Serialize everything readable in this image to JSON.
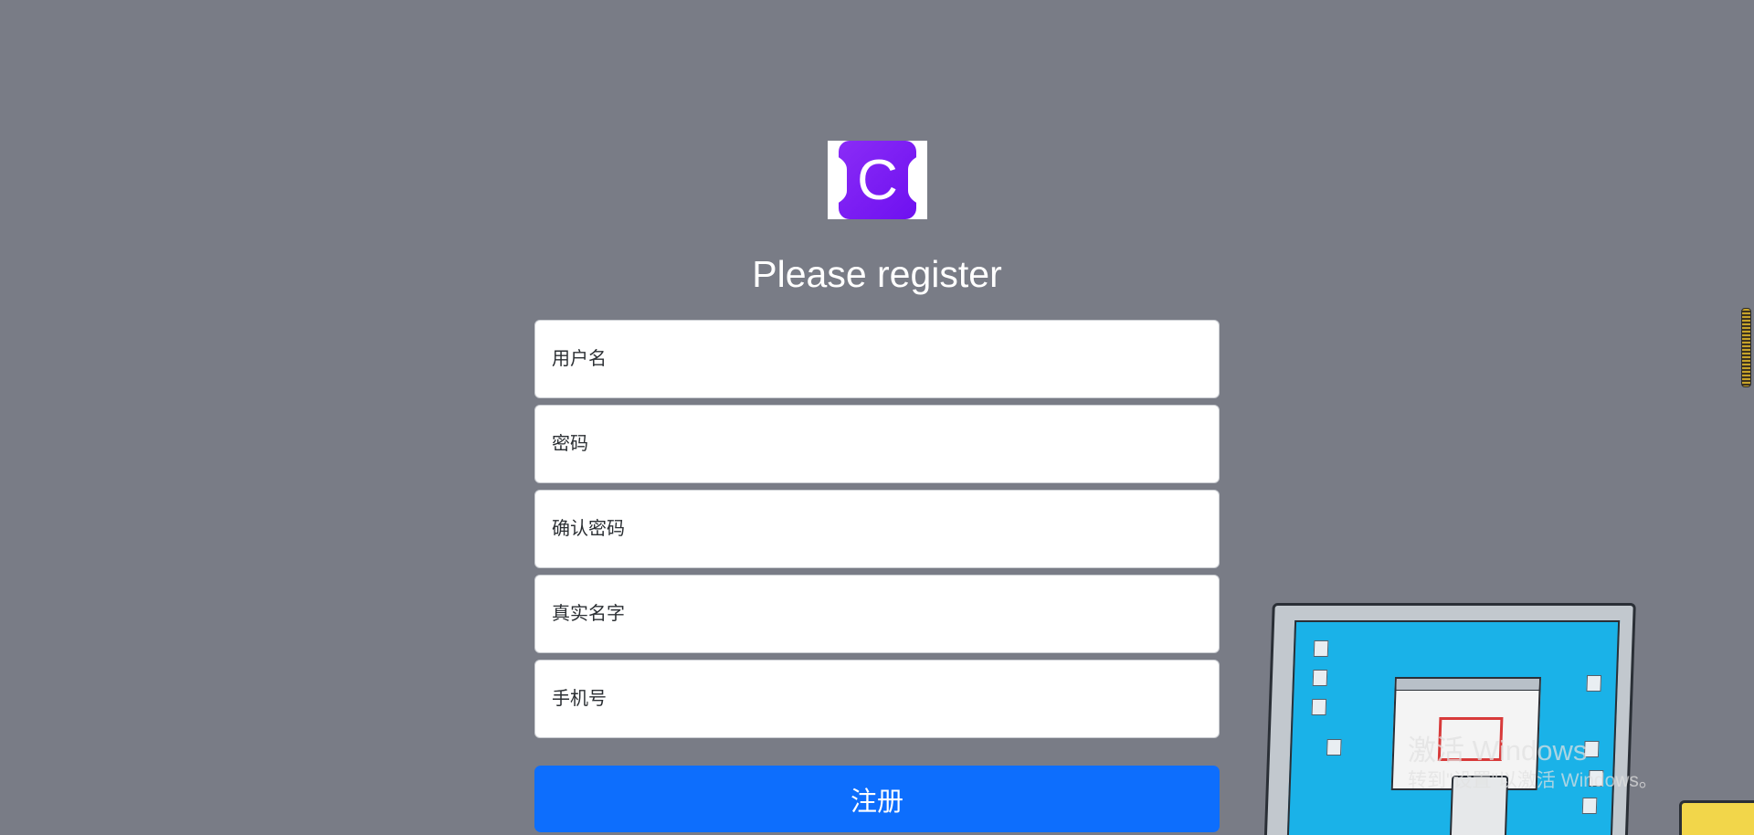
{
  "brand": {
    "logo_letter": "C",
    "logo_color": "#7a1ef5"
  },
  "heading": "Please register",
  "form": {
    "username": {
      "placeholder": "用户名",
      "value": ""
    },
    "password": {
      "placeholder": "密码",
      "value": ""
    },
    "confirm_password": {
      "placeholder": "确认密码",
      "value": ""
    },
    "real_name": {
      "placeholder": "真实名字",
      "value": ""
    },
    "phone": {
      "placeholder": "手机号",
      "value": ""
    },
    "submit_label": "注册"
  },
  "colors": {
    "background": "#797c86",
    "primary_button": "#0d6efd"
  },
  "watermark": {
    "line1": "激活 Windows",
    "line2": "转到\"设置\"以激活 Windows。"
  }
}
